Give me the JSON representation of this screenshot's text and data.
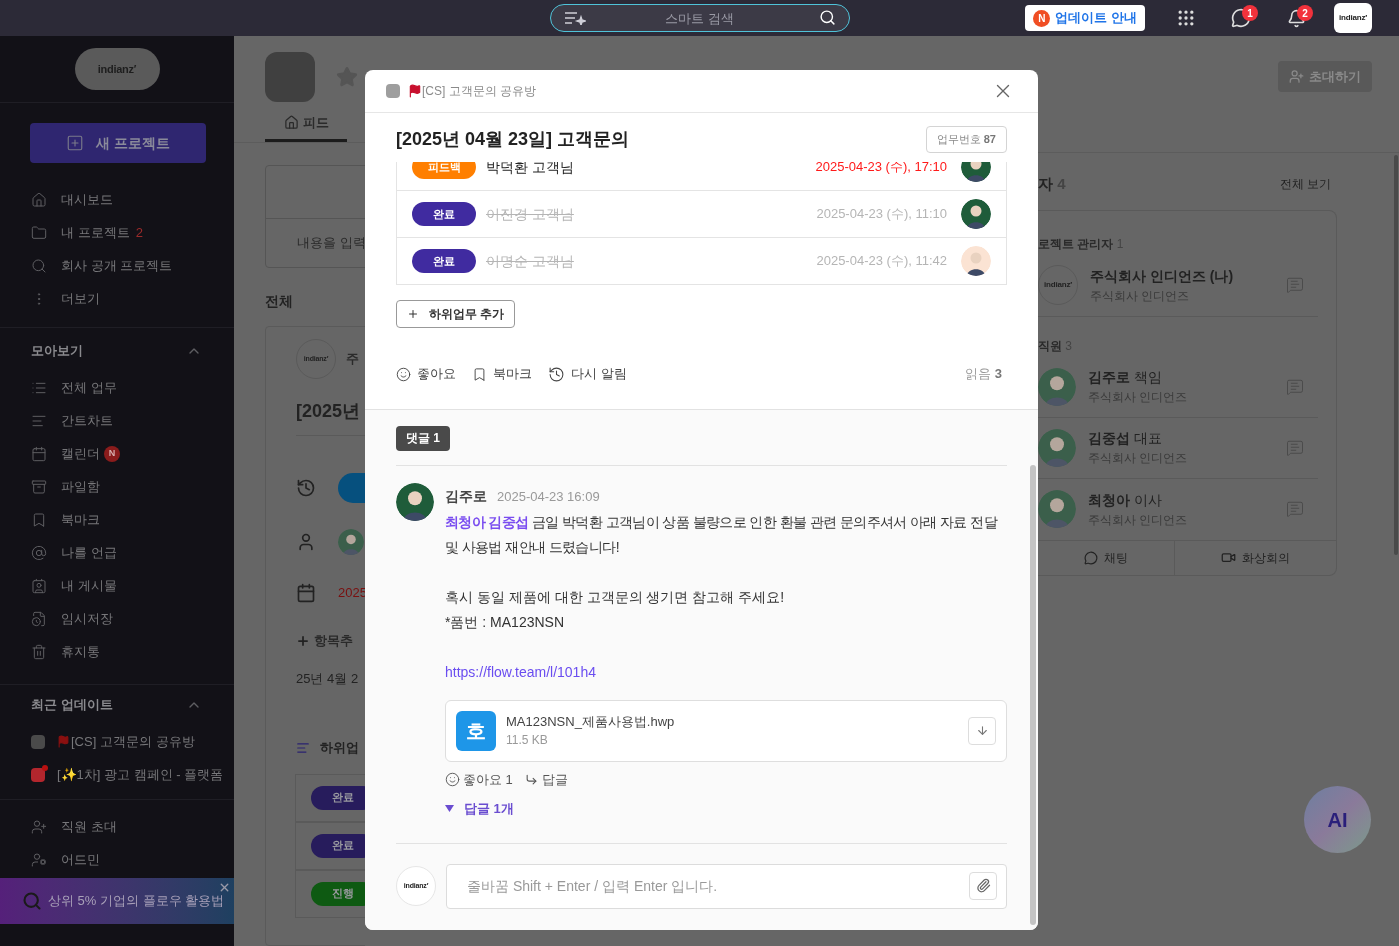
{
  "topbar": {
    "search_placeholder": "스마트 검색",
    "update_badge": "N",
    "update_label": "업데이트 안내",
    "chat_count": "1",
    "alert_count": "2",
    "avatar_logo": "indianz′"
  },
  "sidebar": {
    "logo": "indianz′",
    "new_project": "새 프로젝트",
    "nav": [
      {
        "label": "대시보드",
        "kind": "home"
      },
      {
        "label": "내 프로젝트",
        "kind": "folder",
        "count": "2"
      },
      {
        "label": "회사 공개 프로젝트",
        "kind": "search"
      },
      {
        "label": "더보기",
        "kind": "more"
      }
    ],
    "collect": {
      "title": "모아보기",
      "expanded": true,
      "items": [
        {
          "label": "전체 업무",
          "kind": "list"
        },
        {
          "label": "간트차트",
          "kind": "gantt"
        },
        {
          "label": "캘린더",
          "kind": "calendar",
          "badge": "N"
        },
        {
          "label": "파일함",
          "kind": "files"
        },
        {
          "label": "북마크",
          "kind": "bookmark"
        },
        {
          "label": "나를 언급",
          "kind": "mention"
        },
        {
          "label": "내 게시물",
          "kind": "posts"
        },
        {
          "label": "임시저장",
          "kind": "drafts"
        },
        {
          "label": "휴지통",
          "kind": "trash"
        }
      ]
    },
    "recent": {
      "title": "최근 업데이트",
      "expanded": true,
      "items": [
        {
          "label": "[CS] 고객문의 공유방",
          "color": "#4a4a4a",
          "flag": true,
          "unread": false
        },
        {
          "label": "[✨1차] 광고 캠페인 - 플랫폼",
          "color": "#b3262d",
          "flag": false,
          "unread": true
        }
      ]
    },
    "bottom": [
      {
        "label": "직원 초대",
        "kind": "invite"
      },
      {
        "label": "어드민",
        "kind": "admin"
      }
    ],
    "promo": "상위 5% 기업의 플로우 활용법"
  },
  "feed_bg": {
    "tab": "피드",
    "input_hint": "내용을 입력",
    "section": "전체",
    "post_logo": "indianz′",
    "post_author": "주",
    "post_title": "[2025년",
    "date": "2025",
    "add_field": "항목추",
    "created": "25년 4월 2",
    "subtasks_label": "하위업",
    "pills": [
      {
        "label": "완료",
        "kind": "done"
      },
      {
        "label": "완료",
        "kind": "done"
      },
      {
        "label": "진행",
        "kind": "progress"
      }
    ]
  },
  "modal": {
    "project": "[CS] 고객문의 공유방",
    "title": "[2025년 04월 23일] 고객문의",
    "task_no_label": "업무번호",
    "task_no": "87",
    "subtasks": [
      {
        "status": "피드백",
        "kind": "feedback",
        "name": "박덕환 고객님",
        "done": false,
        "date": "2025-04-23 (수), 17:10",
        "overdue": true
      },
      {
        "status": "완료",
        "kind": "done",
        "name": "이진경 고객님",
        "done": true,
        "date": "2025-04-23 (수), 11:10",
        "overdue": false
      },
      {
        "status": "완료",
        "kind": "done",
        "name": "이명순 고객님",
        "done": true,
        "date": "2025-04-23 (수), 11:42",
        "overdue": false
      }
    ],
    "add_subtask": "하위업무 추가",
    "actions": [
      {
        "label": "좋아요",
        "kind": "like"
      },
      {
        "label": "북마크",
        "kind": "bookmark"
      },
      {
        "label": "다시 알림",
        "kind": "remind"
      }
    ],
    "read_label": "읽음",
    "read_count": "3",
    "comments_label": "댓글 1",
    "comment": {
      "author": "김주로",
      "time": "2025-04-23 16:09",
      "mention": "최청아 김중섭",
      "first": "금일 박덕환 고객님이 상품 불량으로 인한 환불 관련 문의주셔서 아래 자료 전달 및 사용법 재안내 드렸습니다!",
      "lines": [
        "혹시 동일 제품에 대한 고객문의 생기면 참고해 주세요!",
        "*품번 : MA123NSN"
      ],
      "link": "https://flow.team/l/101h4",
      "file": {
        "glyph": "호",
        "name": "MA123NSN_제품사용법.hwp",
        "size": "11.5 KB"
      },
      "like": "좋아요 1",
      "reply": "답글",
      "replies": "답글 1개"
    },
    "input_logo": "indianz′",
    "input_placeholder": "줄바꿈 Shift + Enter / 입력 Enter 입니다."
  },
  "members_bg": {
    "invite": "초대하기",
    "title": "자",
    "count": "4",
    "view_all": "전체 보기",
    "groups": [
      {
        "title": "로젝트 관리자",
        "count": "1",
        "members": [
          {
            "name": "주식회사 인디언즈 (나)",
            "company": "주식회사 인디언즈",
            "logo": "indianz′"
          }
        ]
      },
      {
        "title": "직원",
        "count": "3",
        "members": [
          {
            "name": "김주로",
            "role": "책임",
            "company": "주식회사 인디언즈"
          },
          {
            "name": "김중섭",
            "role": "대표",
            "company": "주식회사 인디언즈"
          },
          {
            "name": "최청아",
            "role": "이사",
            "company": "주식회사 인디언즈"
          }
        ]
      }
    ],
    "chat": "채팅",
    "video": "화상회의",
    "ai": "AI"
  }
}
